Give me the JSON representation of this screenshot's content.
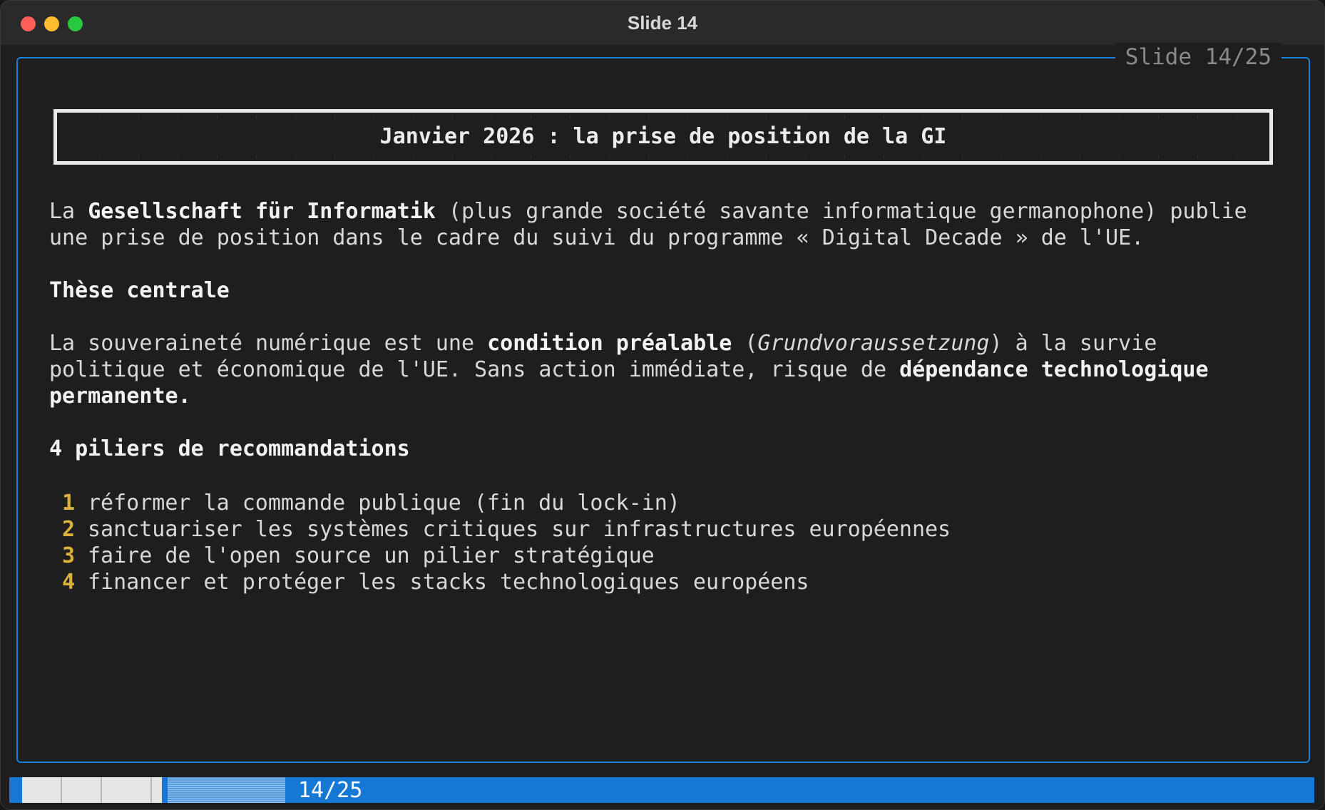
{
  "window": {
    "title": "Slide 14"
  },
  "slide": {
    "counter": "Slide 14/25",
    "heading": "Janvier 2026 : la prise de position de la GI",
    "intro": {
      "line1_a": "La ",
      "line1_b": "Gesellschaft für Informatik",
      "line1_c": " (plus grande société savante informatique germanophone) publie",
      "line2": "une prise de position dans le cadre du suivi du programme « Digital Decade » de l'UE."
    },
    "thesis": {
      "heading": "Thèse centrale",
      "line1_a": "La souveraineté numérique est une ",
      "line1_b": "condition préalable",
      "line1_c": " (",
      "line1_d": "Grundvoraussetzung",
      "line1_e": ") à la survie",
      "line2_a": "politique et économique de l'UE. Sans action immédiate, risque de ",
      "line2_b": "dépendance technologique",
      "line3": "permanente."
    },
    "pillars": {
      "heading": "4 piliers de recommandations",
      "items": [
        {
          "num": "1",
          "text": "réformer la commande publique (fin du lock-in)"
        },
        {
          "num": "2",
          "text": "sanctuariser les systèmes critiques sur infrastructures européennes"
        },
        {
          "num": "3",
          "text": "faire de l'open source un pilier stratégique"
        },
        {
          "num": "4",
          "text": "financer et protéger les stacks technologiques européens"
        }
      ]
    }
  },
  "status": {
    "page_label": "14/25",
    "progress_fraction": 0.56
  },
  "colors": {
    "accent": "#1478d4",
    "frame": "#1a7fd6",
    "number": "#d9b13b",
    "background": "#1e1e1e"
  }
}
